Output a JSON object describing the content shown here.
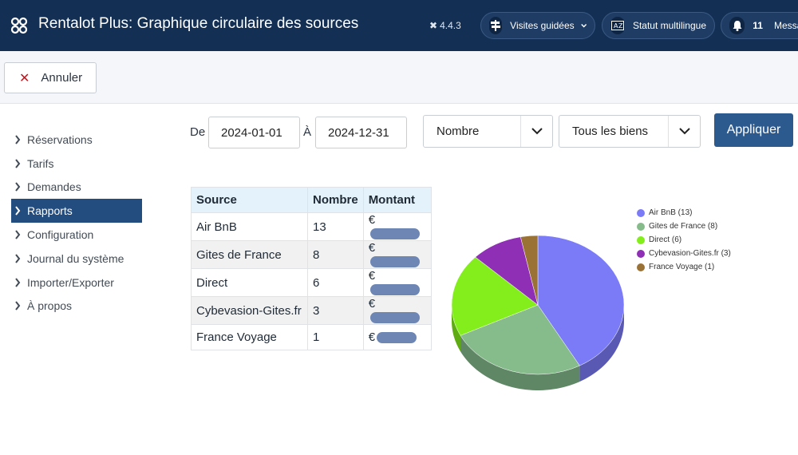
{
  "header": {
    "title": "Rentalot Plus: Graphique circulaire des sources",
    "version": "4.4.3",
    "guided_tours": "Visites guidées",
    "multilingual_status": "Statut multilingue",
    "notifications_count": "11",
    "messages": "Messag"
  },
  "toolbar": {
    "cancel_label": "Annuler"
  },
  "sidebar": {
    "items": [
      {
        "label": "Réservations",
        "active": false
      },
      {
        "label": "Tarifs",
        "active": false
      },
      {
        "label": "Demandes",
        "active": false
      },
      {
        "label": "Rapports",
        "active": true
      },
      {
        "label": "Configuration",
        "active": false
      },
      {
        "label": "Journal du système",
        "active": false
      },
      {
        "label": "Importer/Exporter",
        "active": false
      },
      {
        "label": "À propos",
        "active": false
      }
    ]
  },
  "filters": {
    "from_label": "De",
    "from_value": "2024-01-01",
    "to_label": "À",
    "to_value": "2024-12-31",
    "metric_select": "Nombre",
    "property_select": "Tous les biens",
    "apply_label": "Appliquer"
  },
  "table": {
    "headers": [
      "Source",
      "Nombre",
      "Montant"
    ],
    "currency": "€",
    "rows": [
      {
        "source": "Air BnB",
        "count": "13"
      },
      {
        "source": "Gites de France",
        "count": "8"
      },
      {
        "source": "Direct",
        "count": "6"
      },
      {
        "source": "Cybevasion-Gites.fr",
        "count": "3"
      },
      {
        "source": "France Voyage",
        "count": "1"
      }
    ]
  },
  "chart_data": {
    "type": "pie",
    "categories": [
      "Air BnB",
      "Gites de France",
      "Direct",
      "Cybevasion-Gites.fr",
      "France Voyage"
    ],
    "values": [
      13,
      8,
      6,
      3,
      1
    ],
    "colors": [
      "#7b7bf8",
      "#86bb8c",
      "#84ee1c",
      "#8e2fb5",
      "#9b7236"
    ],
    "legend_labels": [
      "Air BnB (13)",
      "Gites de France (8)",
      "Direct (6)",
      "Cybevasion-Gites.fr (3)",
      "France Voyage (1)"
    ],
    "legend_position": "right",
    "style": "3d"
  }
}
